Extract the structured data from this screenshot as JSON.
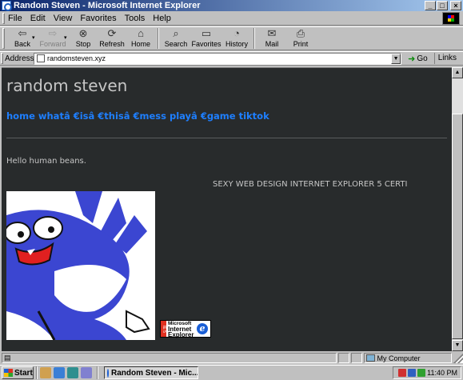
{
  "window": {
    "title": "Random Steven - Microsoft Internet Explorer",
    "controls": {
      "minimize": "_",
      "maximize": "□",
      "close": "×"
    }
  },
  "menubar": {
    "items": [
      "File",
      "Edit",
      "View",
      "Favorites",
      "Tools",
      "Help"
    ]
  },
  "toolbar": {
    "back": "Back",
    "forward": "Forward",
    "stop": "Stop",
    "refresh": "Refresh",
    "home": "Home",
    "search": "Search",
    "favorites": "Favorites",
    "history": "History",
    "mail": "Mail",
    "print": "Print"
  },
  "addressbar": {
    "label": "Address",
    "url": "randomsteven.xyz",
    "go": "Go",
    "links": "Links »"
  },
  "page": {
    "site_title": "random steven",
    "nav": "home whatâ €isâ €thisâ €mess playâ €game tiktok",
    "greeting": "Hello human beans.",
    "marquee": "SEXY WEB DESIGN INTERNET EXPLORER 5 CERTI",
    "badge": {
      "line1": "Microsoft",
      "line2": "Internet",
      "line3": "Explorer",
      "stripe": "IE 5"
    }
  },
  "statusbar": {
    "zone": "My Computer"
  },
  "taskbar": {
    "start": "Start",
    "task": "Random Steven - Mic...",
    "clock": "11:40 PM"
  },
  "colors": {
    "page_bg": "#282b2c",
    "title_text": "#c6c6c6",
    "nav_link": "#1e7fff",
    "creature": "#3b46d1"
  }
}
